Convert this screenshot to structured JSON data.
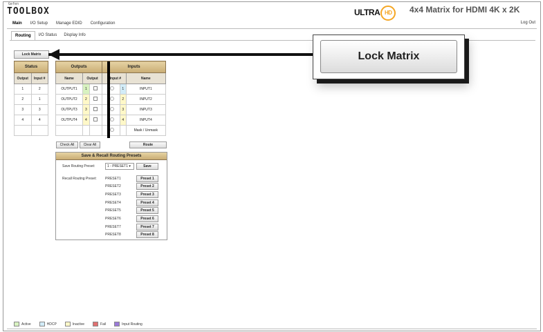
{
  "brand": {
    "small": "Gefen",
    "logo": "TOOLBOX",
    "ultra": "ULTRA",
    "hd": "HD"
  },
  "product_title": "4x4 Matrix for HDMI 4K x 2K",
  "logout": "Log Out",
  "main_tabs": [
    "Main",
    "I/O Setup",
    "Manage EDID",
    "Configuration"
  ],
  "sub_tabs": [
    "Routing",
    "I/O Status",
    "Display Info"
  ],
  "lock_button": "Lock Matrix",
  "callout_label": "Lock Matrix",
  "status_table": {
    "header": "Status",
    "columns": [
      "Output",
      "Input #"
    ],
    "rows": [
      [
        "1",
        "2"
      ],
      [
        "2",
        "1"
      ],
      [
        "3",
        "3"
      ],
      [
        "4",
        "4"
      ]
    ]
  },
  "io_table": {
    "outputs_header": "Outputs",
    "inputs_header": "Inputs",
    "columns": [
      "Name",
      "Output",
      "Input #",
      "Name"
    ],
    "rows": [
      {
        "out_name": "OUTPUT1",
        "out_num": "1",
        "in_num": "1",
        "in_name": "INPUT1"
      },
      {
        "out_name": "OUTPUT2",
        "out_num": "2",
        "in_num": "2",
        "in_name": "INPUT2"
      },
      {
        "out_name": "OUTPUT3",
        "out_num": "3",
        "in_num": "3",
        "in_name": "INPUT3"
      },
      {
        "out_name": "OUTPUT4",
        "out_num": "4",
        "in_num": "4",
        "in_name": "INPUT4"
      }
    ],
    "mask_label": "Mask / Unmask"
  },
  "buttons": {
    "check_all": "Check All",
    "clear_all": "Clear All",
    "route": "Route",
    "save": "Save"
  },
  "presets": {
    "header": "Save & Recall Routing Presets",
    "save_label": "Save Routing Preset:",
    "selected": "1 - PRESET1",
    "recall_label": "Recall Routing Preset:",
    "names": [
      "PRESET1",
      "PRESET2",
      "PRESET3",
      "PRESET4",
      "PRESET5",
      "PRESET6",
      "PRESET7",
      "PRESET8"
    ],
    "buttons": [
      "Preset 1",
      "Preset 2",
      "Preset 3",
      "Preset 4",
      "Preset 5",
      "Preset 6",
      "Preset 7",
      "Preset 8"
    ]
  },
  "legend": [
    {
      "label": "Active",
      "color": "#d8f2c0"
    },
    {
      "label": "HDCP",
      "color": "#d2ecf8"
    },
    {
      "label": "Inactive",
      "color": "#fff8c8"
    },
    {
      "label": "Fail",
      "color": "#e07070"
    },
    {
      "label": "Input Routing",
      "color": "#9a7ad8"
    }
  ]
}
